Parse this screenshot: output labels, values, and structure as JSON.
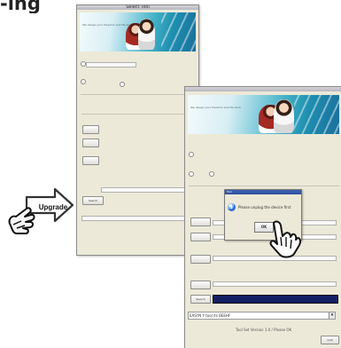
{
  "page": {
    "fragment_heading": "-ing"
  },
  "windows": {
    "back": {
      "title": "Select Tool",
      "banner_caption": "We design your freedom and life work",
      "button_label": "Search"
    },
    "front": {
      "banner_caption": "We design your freedom and life work",
      "button_label": "Search",
      "status_text": "",
      "dropdown_value": "EASYN Y tool its BEEHF",
      "footer_text": "Tool Set Version 1.0 / Please OK",
      "cancel_label": "Quit"
    }
  },
  "callout": {
    "label": "Upgrade"
  },
  "dialog": {
    "title": "Tool",
    "message": "Please unplug the device first",
    "ok_label": "OK"
  },
  "colors": {
    "dialog_title": "#3f65b7",
    "progress": "#12225c",
    "banner_teal": "#43b1c7",
    "window_face": "#ece9d8"
  }
}
